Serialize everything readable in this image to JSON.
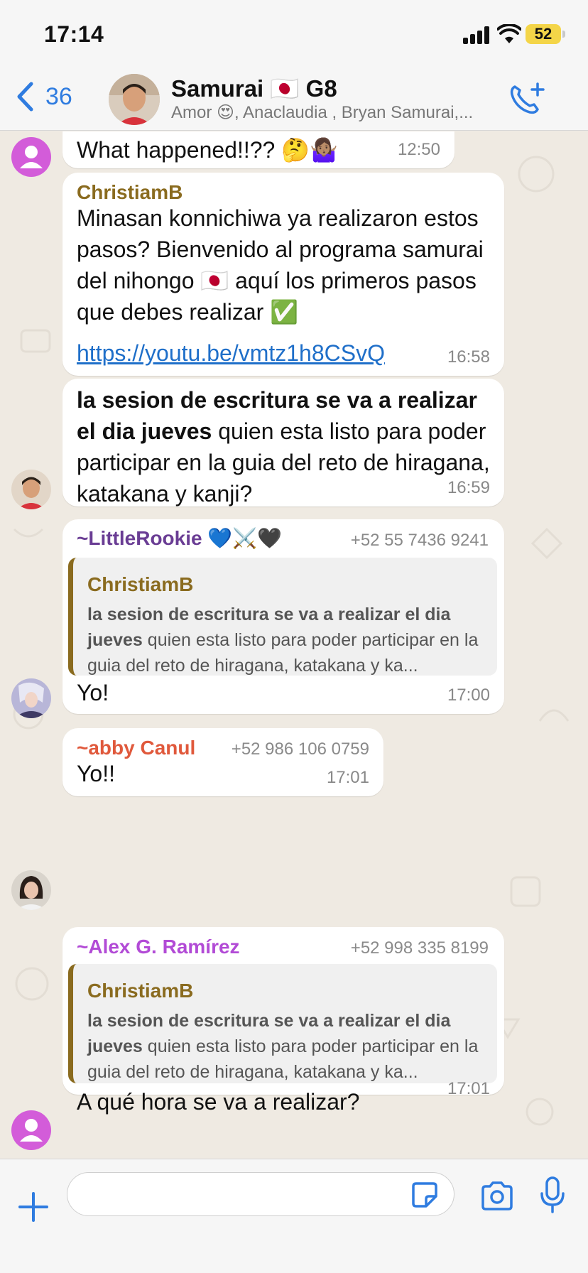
{
  "status": {
    "time": "17:14",
    "battery": "52"
  },
  "header": {
    "back_count": "36",
    "title": "Samurai 🇯🇵 G8",
    "subtitle": "Amor 😍, Anaclaudia , Bryan Samurai,..."
  },
  "messages": [
    {
      "id": "m0",
      "text": "What happened!!?? 🤔🤷🏽‍♀️",
      "time": "12:50"
    },
    {
      "id": "m1",
      "sender": "ChristiamB",
      "text": "Minasan konnichiwa ya realizaron estos pasos? Bienvenido al programa samurai del nihongo 🇯🇵 aquí los primeros pasos que debes realizar ✅",
      "link": "https://youtu.be/vmtz1h8CSvQ",
      "time": "16:58"
    },
    {
      "id": "m2",
      "text_bold": "la sesion de escritura se va a realizar el dia jueves",
      "text_rest": " quien esta listo para poder participar en la guia del reto de hiragana, katakana y kanji?",
      "time": "16:59"
    },
    {
      "id": "m3",
      "sender": "~LittleRookie 💙⚔️🖤",
      "phone": "+52 55 7436 9241",
      "quote": {
        "name": "ChristiamB",
        "bold": "la sesion de escritura se va a realizar el dia jueves",
        "rest": " quien esta listo para poder participar en la guia del reto de hiragana, katakana y ka..."
      },
      "text": "Yo!",
      "time": "17:00"
    },
    {
      "id": "m4",
      "sender": "~abby Canul",
      "phone": "+52 986 106 0759",
      "text": "Yo!!",
      "time": "17:01"
    },
    {
      "id": "m5",
      "sender": "~Alex G. Ramírez",
      "phone": "+52 998 335 8199",
      "quote": {
        "name": "ChristiamB",
        "bold": "la sesion de escritura se va a realizar el dia jueves",
        "rest": " quien esta listo para poder participar en la guia del reto de hiragana, katakana y ka..."
      },
      "text": "A qué hora se va a realizar?",
      "time": "17:01"
    }
  ],
  "colors": {
    "christiamb": "#8a6b1f",
    "littlerookie": "#6a3d94",
    "abby": "#e0593c",
    "alex": "#b24bd6",
    "accent": "#2f7ce0"
  },
  "icons": [
    "back-chevron-icon",
    "phone-add-icon",
    "plus-icon",
    "sticker-icon",
    "camera-icon",
    "microphone-icon"
  ]
}
